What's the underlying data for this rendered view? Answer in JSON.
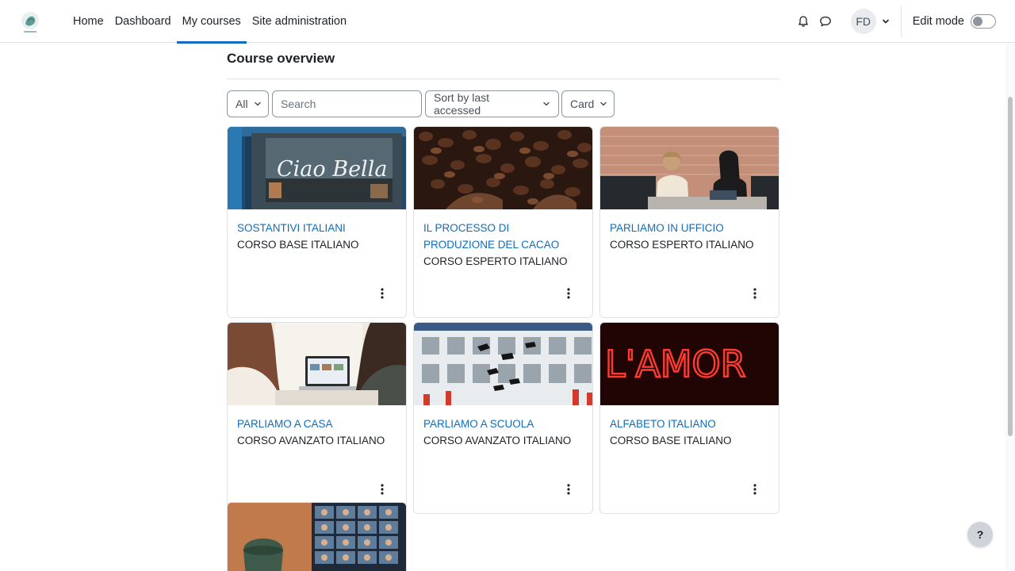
{
  "nav": {
    "items": [
      {
        "label": "Home"
      },
      {
        "label": "Dashboard"
      },
      {
        "label": "My courses"
      },
      {
        "label": "Site administration"
      }
    ],
    "active_index": 2,
    "user_initials": "FD",
    "edit_mode_label": "Edit mode",
    "edit_mode_on": false,
    "icons": [
      "bell-icon",
      "chat-icon",
      "chevron-down-icon"
    ]
  },
  "main": {
    "title": "Course overview",
    "filters": {
      "grouping": "All",
      "search_placeholder": "Search",
      "search_value": "",
      "sort": "Sort by last accessed",
      "view": "Card"
    },
    "courses": [
      {
        "name": "SOSTANTIVI ITALIANI",
        "category": "CORSO BASE ITALIANO",
        "image": "ciao-bella-storefront"
      },
      {
        "name": "IL PROCESSO DI PRODUZIONE DEL CACAO",
        "category": "CORSO ESPERTO ITALIANO",
        "image": "cocoa-beans"
      },
      {
        "name": "PARLIAMO IN UFFICIO",
        "category": "CORSO ESPERTO ITALIANO",
        "image": "office-meeting"
      },
      {
        "name": "PARLIAMO A CASA",
        "category": "CORSO AVANZATO ITALIANO",
        "image": "laptop-at-home"
      },
      {
        "name": "PARLIAMO A SCUOLA",
        "category": "CORSO AVANZATO ITALIANO",
        "image": "graduation-caps"
      },
      {
        "name": "ALFABETO ITALIANO",
        "category": "CORSO BASE ITALIANO",
        "image": "lamor-neon-sign"
      },
      {
        "name": "",
        "category": "",
        "image": "video-call-laptop"
      }
    ],
    "neon_text": "L'AMOR",
    "storefront_text": "Ciao Bella"
  },
  "help_label": "?",
  "colors": {
    "link": "#0f6cbf",
    "text": "#1d2125",
    "border": "#dee2e6",
    "neon": "#e0201a"
  }
}
